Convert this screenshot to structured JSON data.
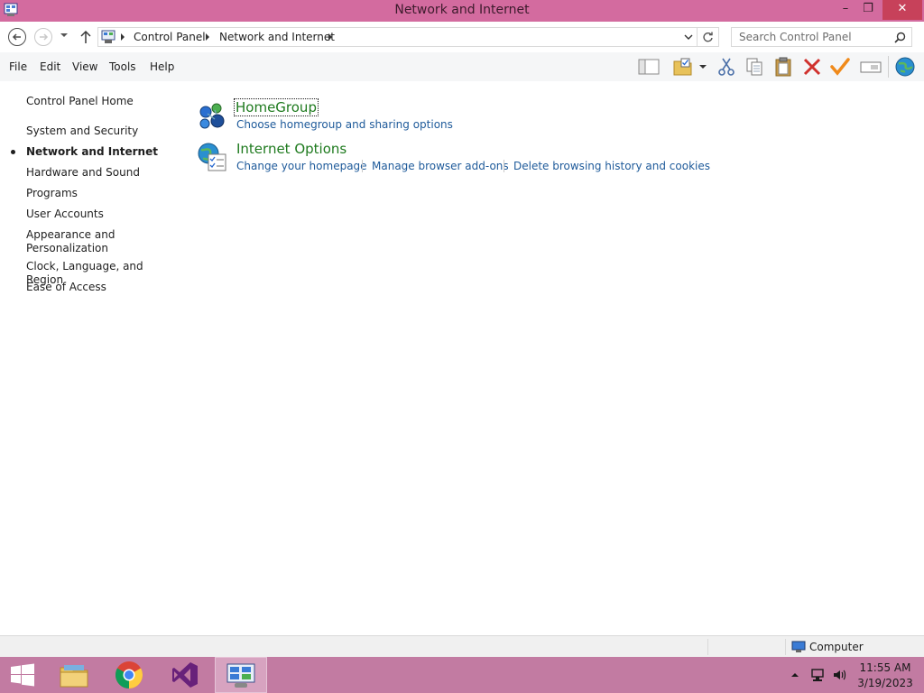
{
  "window": {
    "title": "Network and Internet",
    "minimize": "–",
    "restore": "❐",
    "close": "✕"
  },
  "address": {
    "crumbs": [
      "Control Panel",
      "Network and Internet"
    ],
    "search_placeholder": "Search Control Panel"
  },
  "menu": {
    "items": [
      "File",
      "Edit",
      "View",
      "Tools",
      "Help"
    ]
  },
  "left_nav": {
    "home": "Control Panel Home",
    "items": [
      "System and Security",
      "Network and Internet",
      "Hardware and Sound",
      "Programs",
      "User Accounts",
      "Appearance and Personalization",
      "Clock, Language, and Region",
      "Ease of Access"
    ],
    "active_index": 1
  },
  "categories": [
    {
      "title": "HomeGroup",
      "links": [
        "Choose homegroup and sharing options"
      ]
    },
    {
      "title": "Internet Options",
      "links": [
        "Change your homepage",
        "Manage browser add-ons",
        "Delete browsing history and cookies"
      ]
    }
  ],
  "status": {
    "zone": "Computer"
  },
  "taskbar": {
    "apps": [
      "start",
      "file-explorer",
      "chrome",
      "visual-studio",
      "control-panel"
    ],
    "time": "11:55 AM",
    "date": "3/19/2023"
  },
  "colors": {
    "titlebar": "#d36b9f",
    "taskbar": "#c27ba2",
    "category_title": "#1e7a1e",
    "task_link": "#1e5a9a"
  }
}
